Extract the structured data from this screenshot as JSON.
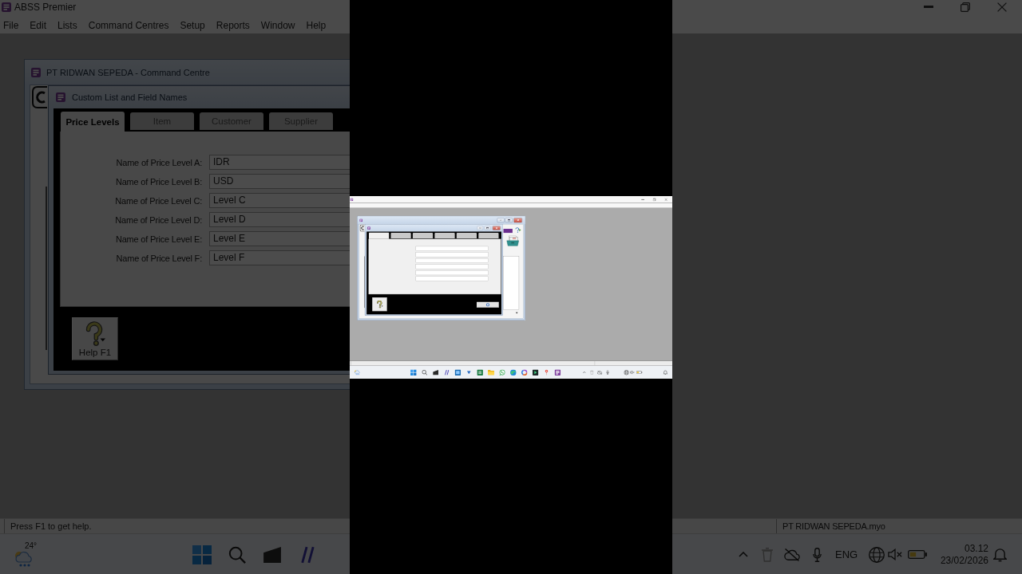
{
  "backdrop_left": {
    "title_bar": {
      "title": "ABSS Premier"
    },
    "menu": [
      "File",
      "Edit",
      "Lists",
      "Command Centres",
      "Setup",
      "Reports",
      "Window",
      "Help"
    ],
    "command_centre": {
      "title": "PT RIDWAN SEPEDA - Command Centre"
    },
    "dialog": {
      "title": "Custom List and Field Names",
      "tabs": [
        {
          "label": "Price Levels",
          "selected": true
        },
        {
          "label": "Item",
          "selected": false
        },
        {
          "label": "Customer",
          "selected": false
        },
        {
          "label": "Supplier",
          "selected": false
        }
      ],
      "fields": [
        {
          "label": "Name of Price Level A:",
          "value": "IDR"
        },
        {
          "label": "Name of Price Level B:",
          "value": "USD"
        },
        {
          "label": "Name of Price Level C:",
          "value": "Level C"
        },
        {
          "label": "Name of Price Level D:",
          "value": "Level D"
        },
        {
          "label": "Name of Price Level E:",
          "value": "Level E"
        },
        {
          "label": "Name of Price Level F:",
          "value": "Level F"
        }
      ],
      "help_button": "Help F1"
    },
    "status_bar": {
      "hint": "Press F1 to get help."
    },
    "taskbar": {
      "temperature": "24°"
    }
  },
  "screen": {
    "dialog": {
      "tabs": [
        {
          "selected": true
        },
        {
          "selected": false
        },
        {
          "selected": false
        },
        {
          "selected": false
        },
        {
          "selected": false
        },
        {
          "selected": false
        }
      ]
    }
  },
  "backdrop_right": {
    "status_bar": {
      "file": "PT RIDWAN SEPEDA.myo"
    },
    "taskbar": {
      "language": "ENG",
      "time": "03.12",
      "date": "23/02/2026"
    }
  }
}
